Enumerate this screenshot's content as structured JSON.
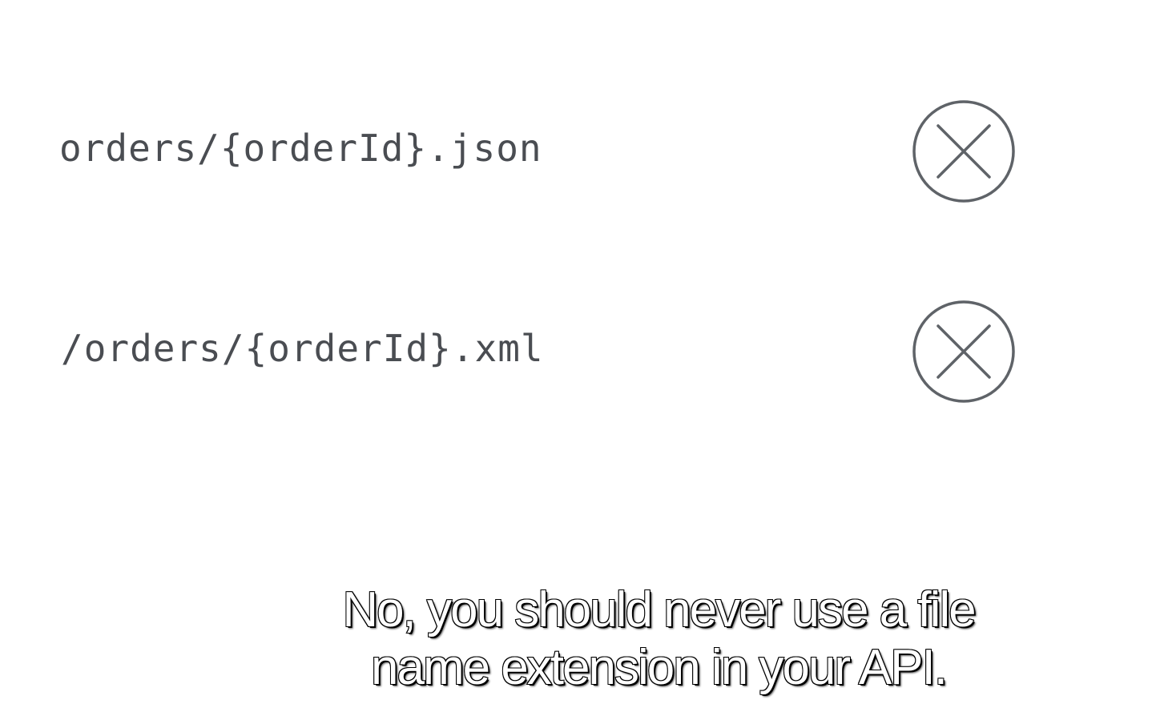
{
  "slide": {
    "rows": [
      {
        "path": "orders/{orderId}.json",
        "mark_icon": "x-circle-icon"
      },
      {
        "path": "/orders/{orderId}.xml",
        "mark_icon": "x-circle-icon"
      }
    ],
    "icon_color": "#5f6368",
    "text_color": "#4a4d52"
  },
  "subtitle": {
    "line1": "No, you should never use a file",
    "line2": "name extension in your API."
  }
}
